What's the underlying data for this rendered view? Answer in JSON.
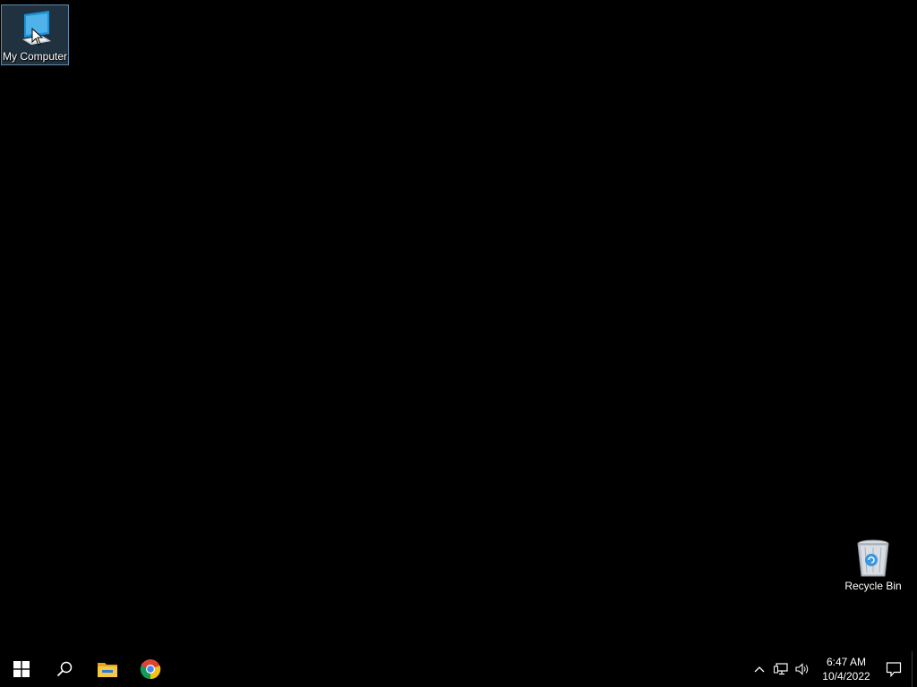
{
  "desktop": {
    "icons": [
      {
        "label": "My Computer",
        "icon": "monitor-icon",
        "selected": true
      },
      {
        "label": "Recycle Bin",
        "icon": "recycle-bin-icon",
        "selected": false
      }
    ]
  },
  "taskbar": {
    "start_icon": "windows-logo-icon",
    "search_icon": "search-icon",
    "pinned": [
      {
        "icon": "file-explorer-icon"
      },
      {
        "icon": "chrome-icon"
      }
    ],
    "tray": {
      "icons": [
        "chevron-up-icon",
        "network-icon",
        "volume-icon"
      ],
      "time": "6:47 AM",
      "date": "10/4/2022",
      "notification_icon": "action-center-icon"
    }
  },
  "colors": {
    "desktop_bg": "#000000",
    "taskbar_bg": "#000000",
    "selection_bg": "#466e8c",
    "accent_blue": "#1e90d6"
  }
}
